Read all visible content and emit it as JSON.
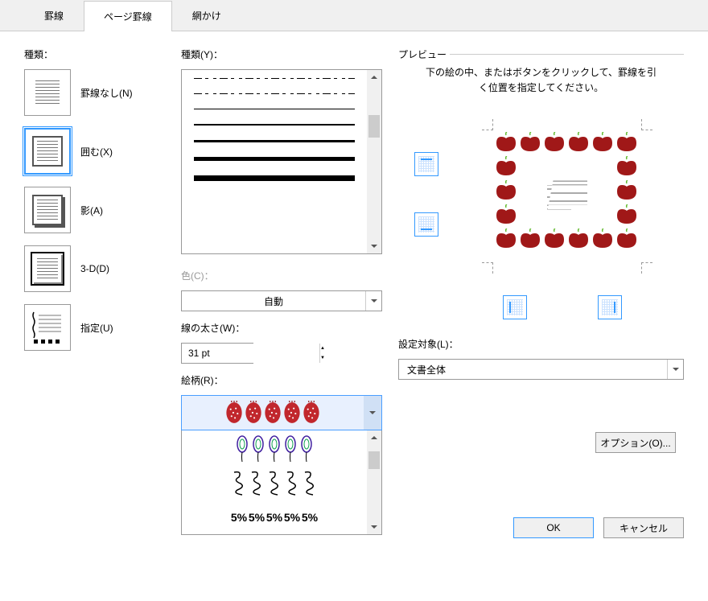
{
  "tabs": {
    "borders": "罫線",
    "page_borders": "ページ罫線",
    "shading": "網かけ"
  },
  "col1": {
    "label": "種類：",
    "none": "罫線なし(N)",
    "box": "囲む(X)",
    "shadow": "影(A)",
    "threed": "3-D(D)",
    "custom": "指定(U)"
  },
  "col2": {
    "style_label": "種類(Y)：",
    "color_label": "色(C)：",
    "color_value": "自動",
    "width_label": "線の太さ(W)：",
    "width_value": "31 pt",
    "art_label": "絵柄(R)："
  },
  "col3": {
    "preview_label": "プレビュー",
    "preview_hint": "下の絵の中、またはボタンをクリックして、罫線を引く位置を指定してください。",
    "apply_label": "設定対象(L)：",
    "apply_value": "文書全体",
    "options": "オプション(O)..."
  },
  "buttons": {
    "ok": "OK",
    "cancel": "キャンセル"
  }
}
